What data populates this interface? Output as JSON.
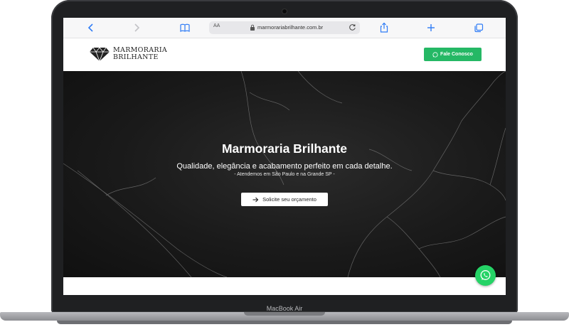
{
  "browser": {
    "text_size_label": "AA",
    "url": "marmorariabrilhante.com.br",
    "icons": [
      "back-icon",
      "forward-icon",
      "bookmarks-icon",
      "lock-icon",
      "reload-icon",
      "share-icon",
      "new-tab-icon",
      "tabs-icon"
    ]
  },
  "site": {
    "logo_line1": "MARMORARIA",
    "logo_line2": "BRILHANTE",
    "header_cta": "Fale Conosco",
    "hero_title": "Marmoraria Brilhante",
    "hero_subtitle": "Qualidade, elegância e acabamento perfeito em cada detalhe.",
    "hero_note": "- Atendemos em São Paulo e na Grande SP -",
    "hero_button": "Solicite seu orçamento"
  },
  "device": {
    "label": "MacBook Air"
  },
  "colors": {
    "accent_green": "#25b865",
    "whatsapp_green": "#25d366",
    "hero_bg": "#1a1a1a"
  }
}
